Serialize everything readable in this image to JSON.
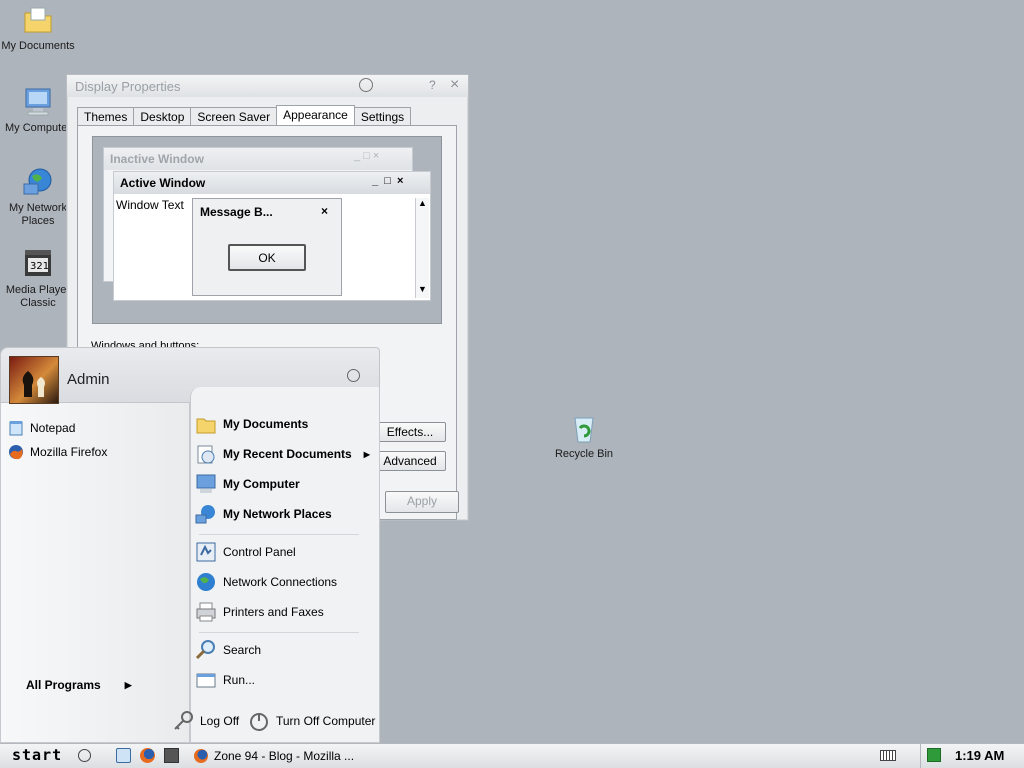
{
  "desktop": {
    "icons": [
      {
        "label": "My Documents",
        "icon": "folder-documents-icon"
      },
      {
        "label": "My Computer",
        "icon": "computer-icon"
      },
      {
        "label": "My Network Places",
        "icon": "network-globe-icon"
      },
      {
        "label": "Media Player Classic",
        "icon": "media-player-icon"
      },
      {
        "label": "Recycle Bin",
        "icon": "recycle-bin-icon"
      }
    ]
  },
  "display_properties": {
    "title": "Display Properties",
    "title_buttons": {
      "help": "?",
      "close": "×"
    },
    "tabs": [
      "Themes",
      "Desktop",
      "Screen Saver",
      "Appearance",
      "Settings"
    ],
    "active_tab": "Appearance",
    "preview": {
      "inactive_title": "Inactive Window",
      "active_title": "Active Window",
      "window_text": "Window Text",
      "message_title": "Message B...",
      "ok_label": "OK"
    },
    "windows_buttons_label": "Windows and buttons:",
    "effects_label": "Effects...",
    "advanced_label": "Advanced",
    "apply_label": "Apply"
  },
  "start_menu": {
    "user_name": "Admin",
    "pinned": [
      {
        "label": "Notepad",
        "icon": "notepad-icon"
      },
      {
        "label": "Mozilla Firefox",
        "icon": "firefox-icon"
      }
    ],
    "all_programs": "All Programs",
    "right_bold": [
      {
        "label": "My Documents",
        "icon": "folder-documents-icon"
      },
      {
        "label": "My Recent Documents",
        "icon": "recent-documents-icon",
        "arrow": "›"
      },
      {
        "label": "My Computer",
        "icon": "computer-icon"
      },
      {
        "label": "My Network Places",
        "icon": "network-globe-icon"
      }
    ],
    "right_settings": [
      {
        "label": "Control Panel",
        "icon": "control-panel-icon"
      },
      {
        "label": "Network Connections",
        "icon": "network-connections-icon"
      },
      {
        "label": "Printers and Faxes",
        "icon": "printer-icon"
      }
    ],
    "right_tools": [
      {
        "label": "Search",
        "icon": "search-icon"
      },
      {
        "label": "Run...",
        "icon": "run-icon"
      }
    ],
    "log_off": "Log Off",
    "turn_off": "Turn Off Computer"
  },
  "taskbar": {
    "start_label": "start",
    "window_button": "Zone 94 - Blog - Mozilla ...",
    "clock": "1:19 AM"
  }
}
